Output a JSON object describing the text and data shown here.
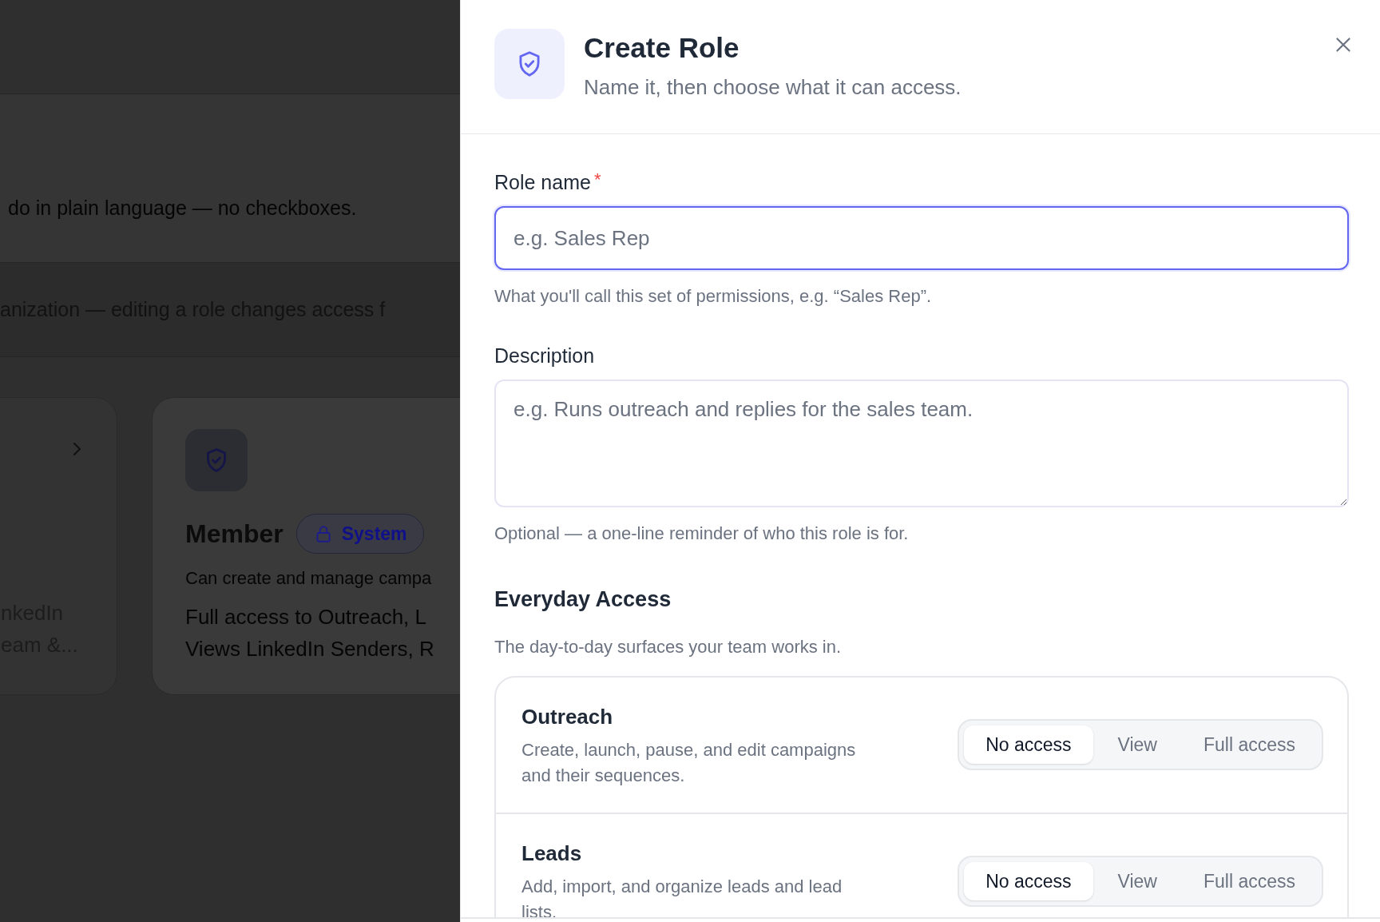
{
  "background": {
    "intro_fragment": "do in plain language — no checkboxes.",
    "notice_fragment": "anization — editing a role changes access f",
    "cards": [
      {
        "kind": "partial",
        "lines": [
          "nkedIn",
          "eam &..."
        ]
      },
      {
        "kind": "role",
        "title": "Member",
        "badge": "System",
        "description": "Can create and manage campa",
        "lines": [
          "Full access to Outreach, L",
          "Views LinkedIn Senders, R"
        ]
      }
    ]
  },
  "panel": {
    "title": "Create Role",
    "subtitle": "Name it, then choose what it can access.",
    "role_name": {
      "label": "Role name",
      "required": true,
      "required_mark": "*",
      "placeholder": "e.g. Sales Rep",
      "help": "What you'll call this set of permissions, e.g. “Sales Rep”.",
      "focused": true
    },
    "description": {
      "label": "Description",
      "placeholder": "e.g. Runs outreach and replies for the sales team.",
      "help": "Optional — a one-line reminder of who this role is for."
    },
    "section": {
      "title": "Everyday Access",
      "subtitle": "The day-to-day surfaces your team works in.",
      "permissions": [
        {
          "title": "Outreach",
          "description": "Create, launch, pause, and edit campaigns and their sequences.",
          "options": [
            {
              "label": "No access",
              "selected": true
            },
            {
              "label": "View",
              "selected": false
            },
            {
              "label": "Full access",
              "selected": false
            }
          ]
        },
        {
          "title": "Leads",
          "description": "Add, import, and organize leads and lead lists.",
          "options": [
            {
              "label": "No access",
              "selected": true
            },
            {
              "label": "View",
              "selected": false
            },
            {
              "label": "Full access",
              "selected": false
            }
          ]
        }
      ]
    }
  }
}
